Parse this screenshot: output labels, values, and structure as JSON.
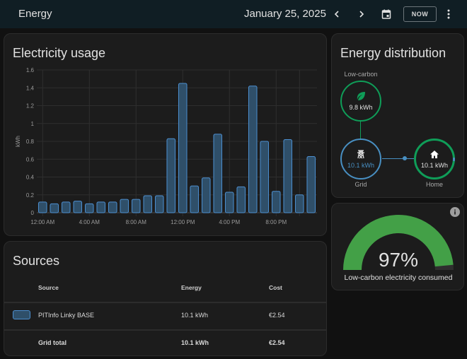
{
  "header": {
    "title": "Energy",
    "date": "January 25, 2025",
    "now_label": "NOW",
    "icons": [
      "chevron-left-icon",
      "chevron-right-icon",
      "calendar-icon",
      "more-vert-icon"
    ]
  },
  "usage_card": {
    "title": "Electricity usage"
  },
  "chart_data": {
    "type": "bar",
    "title": "Electricity usage",
    "xlabel": "",
    "ylabel": "kWh",
    "ylim": [
      0,
      1.6
    ],
    "yticks": [
      "0",
      "0.2",
      "0.4",
      "0.6",
      "0.8",
      "1",
      "1.2",
      "1.4",
      "1.6"
    ],
    "xtick_labels": [
      "12:00 AM",
      "4:00 AM",
      "8:00 AM",
      "12:00 PM",
      "4:00 PM",
      "8:00 PM"
    ],
    "categories": [
      "00:00",
      "01:00",
      "02:00",
      "03:00",
      "04:00",
      "05:00",
      "06:00",
      "07:00",
      "08:00",
      "09:00",
      "10:00",
      "11:00",
      "12:00",
      "13:00",
      "14:00",
      "15:00",
      "16:00",
      "17:00",
      "18:00",
      "19:00",
      "20:00",
      "21:00",
      "22:00",
      "23:00"
    ],
    "series": [
      {
        "name": "PITInfo Linky BASE",
        "color": "#4c8fd0",
        "values": [
          0.12,
          0.1,
          0.12,
          0.13,
          0.1,
          0.12,
          0.12,
          0.15,
          0.15,
          0.19,
          0.19,
          0.83,
          1.45,
          0.3,
          0.39,
          0.88,
          0.23,
          0.29,
          1.42,
          0.8,
          0.24,
          0.82,
          0.2,
          0.63
        ]
      }
    ],
    "grid": true,
    "legend": "none"
  },
  "sources_card": {
    "title": "Sources",
    "columns": [
      "Source",
      "Energy",
      "Cost"
    ],
    "rows": [
      {
        "source": "PITInfo Linky BASE",
        "energy": "10.1 kWh",
        "cost": "€2.54",
        "color": "#4c8fd0"
      }
    ],
    "total": {
      "label": "Grid total",
      "energy": "10.1 kWh",
      "cost": "€2.54"
    }
  },
  "distribution_card": {
    "title": "Energy distribution",
    "low_carbon": {
      "label": "Low-carbon",
      "value": "9.8 kWh",
      "color": "#0f9d58"
    },
    "grid": {
      "label": "Grid",
      "value": "10.1 kWh",
      "color": "#488fc2"
    },
    "home": {
      "label": "Home",
      "value": "10.1 kWh",
      "color": "#0f9d58"
    }
  },
  "gauge_card": {
    "value": 97,
    "value_label": "97%",
    "caption": "Low-carbon electricity consumed",
    "color": "#43a047"
  },
  "colors": {
    "accent_blue": "#4c8fd0",
    "accent_green": "#0f9d58",
    "gauge_green": "#43a047",
    "header_bg": "#101e24",
    "card_bg": "#1c1c1c"
  }
}
